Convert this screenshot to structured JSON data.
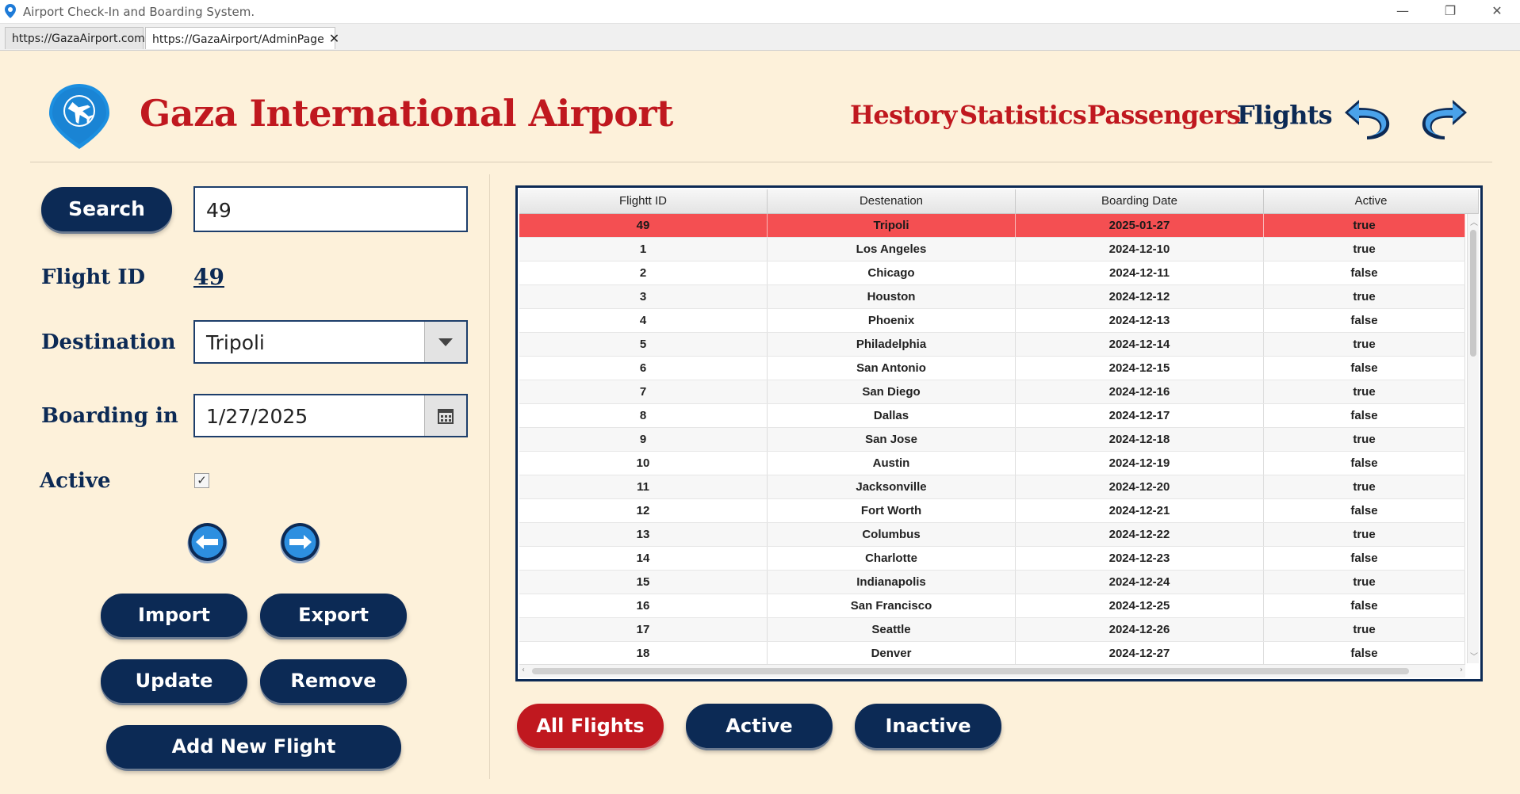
{
  "window": {
    "title": "Airport Check-In and Boarding System."
  },
  "tabs": [
    {
      "label": "https://GazaAirport.com",
      "close": ""
    },
    {
      "label": "https://GazaAirport/AdminPage",
      "close": "✕"
    }
  ],
  "header": {
    "brand": "Gaza International Airport",
    "nav": [
      "Hestory",
      "Statistics",
      "Passengers",
      "Flights"
    ],
    "current_nav": "Flights"
  },
  "form": {
    "search_label": "Search",
    "search_value": "49",
    "flight_id_label": "Flight ID",
    "flight_id_value": "49",
    "destination_label": "Destination",
    "destination_value": "Tripoli",
    "boarding_label": "Boarding in",
    "boarding_value": "1/27/2025",
    "active_label": "Active",
    "active_checked": true,
    "active_check_glyph": "✓",
    "buttons": {
      "import": "Import",
      "export": "Export",
      "update": "Update",
      "remove": "Remove",
      "add": "Add New Flight"
    }
  },
  "table": {
    "headers": [
      "Flightt ID",
      "Destenation",
      "Boarding Date",
      "Active"
    ],
    "rows": [
      [
        "49",
        "Tripoli",
        "2025-01-27",
        "true"
      ],
      [
        "1",
        "Los Angeles",
        "2024-12-10",
        "true"
      ],
      [
        "2",
        "Chicago",
        "2024-12-11",
        "false"
      ],
      [
        "3",
        "Houston",
        "2024-12-12",
        "true"
      ],
      [
        "4",
        "Phoenix",
        "2024-12-13",
        "false"
      ],
      [
        "5",
        "Philadelphia",
        "2024-12-14",
        "true"
      ],
      [
        "6",
        "San Antonio",
        "2024-12-15",
        "false"
      ],
      [
        "7",
        "San Diego",
        "2024-12-16",
        "true"
      ],
      [
        "8",
        "Dallas",
        "2024-12-17",
        "false"
      ],
      [
        "9",
        "San Jose",
        "2024-12-18",
        "true"
      ],
      [
        "10",
        "Austin",
        "2024-12-19",
        "false"
      ],
      [
        "11",
        "Jacksonville",
        "2024-12-20",
        "true"
      ],
      [
        "12",
        "Fort Worth",
        "2024-12-21",
        "false"
      ],
      [
        "13",
        "Columbus",
        "2024-12-22",
        "true"
      ],
      [
        "14",
        "Charlotte",
        "2024-12-23",
        "false"
      ],
      [
        "15",
        "Indianapolis",
        "2024-12-24",
        "true"
      ],
      [
        "16",
        "San Francisco",
        "2024-12-25",
        "false"
      ],
      [
        "17",
        "Seattle",
        "2024-12-26",
        "true"
      ],
      [
        "18",
        "Denver",
        "2024-12-27",
        "false"
      ]
    ],
    "selected_row": 0
  },
  "filters": {
    "all": "All Flights",
    "active": "Active",
    "inactive": "Inactive",
    "selected": "all"
  },
  "colors": {
    "navy": "#0c2a55",
    "red": "#c0181f",
    "background": "#fdf1da",
    "selected_row": "#f44f52"
  },
  "icons": {
    "app": "location-pin-icon",
    "logo": "airplane-pin-icon",
    "undo": "undo-arrow-icon",
    "redo": "redo-arrow-icon",
    "prev": "left-arrow-icon",
    "next": "right-arrow-icon",
    "dropdown": "chevron-down-icon",
    "calendar": "calendar-icon"
  }
}
